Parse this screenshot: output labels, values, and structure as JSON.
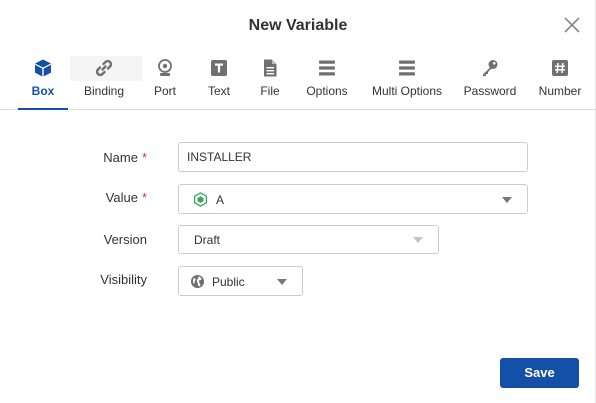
{
  "dialog": {
    "title": "New Variable",
    "close_icon": "close-icon"
  },
  "tabs": [
    {
      "label": "Box",
      "icon": "cube-icon",
      "active": true
    },
    {
      "label": "Binding",
      "icon": "link-icon",
      "active": false
    },
    {
      "label": "Port",
      "icon": "port-icon",
      "active": false
    },
    {
      "label": "Text",
      "icon": "text-icon",
      "active": false
    },
    {
      "label": "File",
      "icon": "file-icon",
      "active": false
    },
    {
      "label": "Options",
      "icon": "options-icon",
      "active": false
    },
    {
      "label": "Multi Options",
      "icon": "multi-options-icon",
      "active": false
    },
    {
      "label": "Password",
      "icon": "key-icon",
      "active": false
    },
    {
      "label": "Number",
      "icon": "hash-icon",
      "active": false
    }
  ],
  "form": {
    "name": {
      "label": "Name",
      "required_mark": "*",
      "value": "INSTALLER"
    },
    "value": {
      "label": "Value",
      "required_mark": "*",
      "selected": "A",
      "icon": "box-icon"
    },
    "version": {
      "label": "Version",
      "selected": "Draft"
    },
    "visibility": {
      "label": "Visibility",
      "selected": "Public",
      "icon": "globe-icon"
    }
  },
  "actions": {
    "save_label": "Save"
  },
  "colors": {
    "accent": "#1550a8",
    "required": "#d9342b",
    "icon_gray": "#707070",
    "box_green": "#3aa657"
  }
}
